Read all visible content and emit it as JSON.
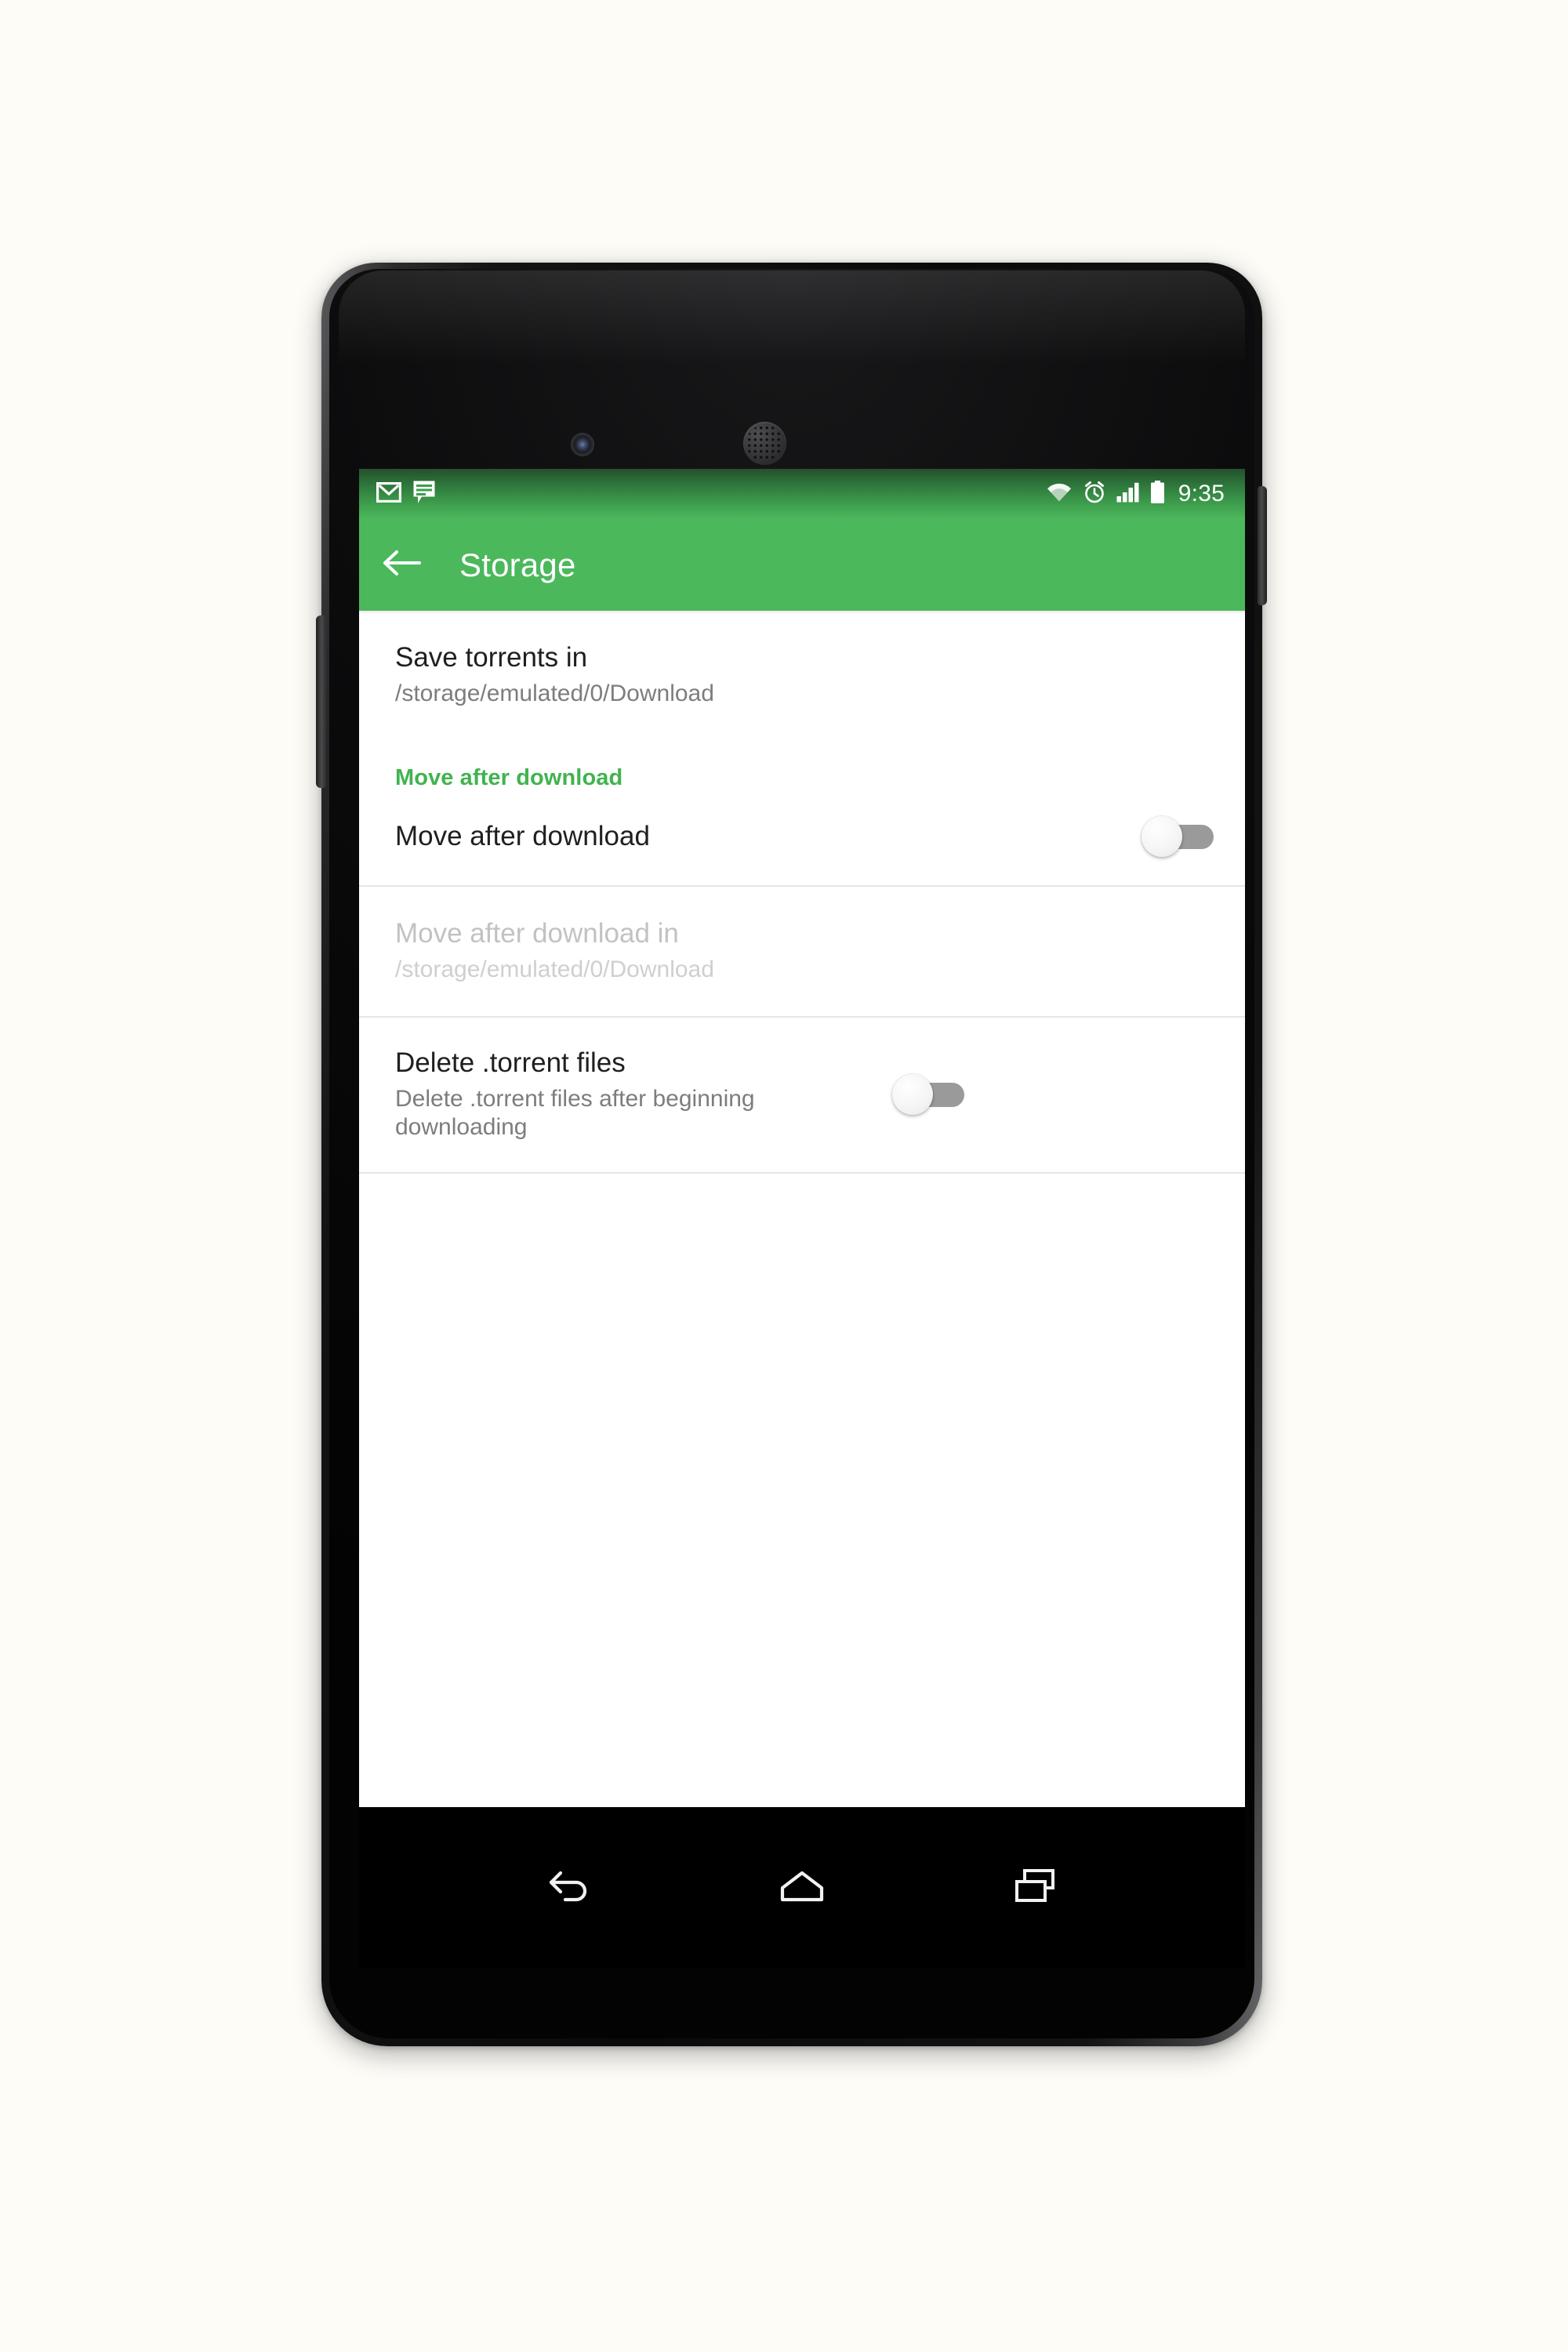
{
  "device": {
    "type": "android-phone",
    "camera_icon": "front-camera",
    "speaker_icon": "earpiece-speaker"
  },
  "colors": {
    "accent_green": "#4CB85C",
    "status_bar_dark_green": "#24502D",
    "section_header_green": "#41B34F",
    "page_background": "#FDFCF7",
    "divider": "#E6E6E6",
    "title_text": "#1F1F1F",
    "subtitle_text": "#7D7D7D",
    "disabled_title_text": "#C2C2C2",
    "disabled_subtitle_text": "#CFCFCF",
    "switch_track_off": "#9A9A9A",
    "switch_thumb_off": "#F4F4F4"
  },
  "status_bar": {
    "notification_icons": [
      "gmail-icon",
      "message-icon"
    ],
    "system_icons": [
      "wifi-icon",
      "alarm-icon",
      "signal-icon",
      "battery-icon"
    ],
    "time": "9:35"
  },
  "toolbar": {
    "back_icon": "back-arrow-icon",
    "title": "Storage"
  },
  "settings": {
    "rows": [
      {
        "name": "save-torrents-in",
        "title": "Save torrents in",
        "subtitle": "/storage/emulated/0/Download",
        "has_switch": false,
        "disabled": false
      },
      {
        "name": "move-after-download",
        "title": "Move after download",
        "subtitle": "",
        "has_switch": true,
        "switch_state": "off",
        "disabled": false
      },
      {
        "name": "move-after-download-in",
        "title": "Move after download in",
        "subtitle": "/storage/emulated/0/Download",
        "has_switch": false,
        "disabled": true
      },
      {
        "name": "delete-torrent-files",
        "title": "Delete .torrent files",
        "subtitle": "Delete .torrent files after beginning downloading",
        "has_switch": true,
        "switch_state": "off",
        "disabled": false
      }
    ],
    "section_header": "Move after download"
  },
  "nav_bar": {
    "back_label": "back-icon",
    "home_label": "home-icon",
    "recents_label": "recents-icon"
  }
}
